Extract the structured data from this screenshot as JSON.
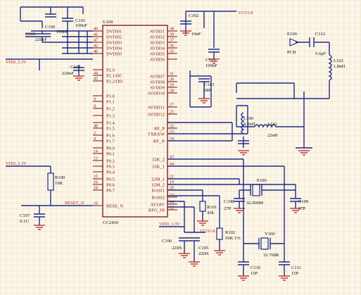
{
  "chip": {
    "designator": "U100",
    "part": "CC2430",
    "left_pins": [
      {
        "num": "40",
        "name": "DVDD1"
      },
      {
        "num": "41",
        "name": "DVDD2"
      },
      {
        "num": "47",
        "name": "DVDD3"
      },
      {
        "num": "42",
        "name": "DVDD4"
      },
      {
        "num": "46",
        "name": "DVDD5"
      },
      {
        "num": "",
        "name": "P2.0"
      },
      {
        "num": "44",
        "name": "P2.1/DC"
      },
      {
        "num": "45",
        "name": "P2.2/DD"
      },
      {
        "num": "",
        "name": "P1.0"
      },
      {
        "num": "9",
        "name": "P1.1"
      },
      {
        "num": "8",
        "name": "P1.2"
      },
      {
        "num": "",
        "name": "P1.3"
      },
      {
        "num": "",
        "name": "P1.4"
      },
      {
        "num": "48",
        "name": "P1.5"
      },
      {
        "num": "2",
        "name": "P1.6"
      },
      {
        "num": "4",
        "name": "P1.7"
      },
      {
        "num": "",
        "name": "P0.0"
      },
      {
        "num": "14",
        "name": "P0.1"
      },
      {
        "num": "13",
        "name": "P0.2"
      },
      {
        "num": "",
        "name": "P0.3"
      },
      {
        "num": "",
        "name": "P0.4"
      },
      {
        "num": "15",
        "name": "P0.5"
      },
      {
        "num": "16",
        "name": "P0.6"
      },
      {
        "num": "18",
        "name": "P0.7"
      },
      {
        "num": "10",
        "name": "RESE_N"
      }
    ],
    "right_pins": [
      {
        "num": "38",
        "name": "AVDD1"
      },
      {
        "num": "39",
        "name": "AVDD2"
      },
      {
        "num": "37",
        "name": "AVDD3"
      },
      {
        "num": "36",
        "name": "AVDD4"
      },
      {
        "num": "35",
        "name": "AVDD5"
      },
      {
        "num": "",
        "name": "AVDD6"
      },
      {
        "num": "31",
        "name": "AVDD7"
      },
      {
        "num": "30",
        "name": "AVDD8"
      },
      {
        "num": "29",
        "name": "AVDD9"
      },
      {
        "num": "28",
        "name": "AVDD10"
      },
      {
        "num": "27",
        "name": "AVDD11"
      },
      {
        "num": "25",
        "name": "AVDD12"
      },
      {
        "num": "32",
        "name": "RF_P"
      },
      {
        "num": "33",
        "name": "TXRXW"
      },
      {
        "num": "34",
        "name": "RF_N"
      },
      {
        "num": "43",
        "name": "32K_2"
      },
      {
        "num": "44",
        "name": "32K_1"
      },
      {
        "num": "21",
        "name": "32M_1"
      },
      {
        "num": "19",
        "name": "32M_2"
      },
      {
        "num": "20",
        "name": "BASI1"
      },
      {
        "num": "23",
        "name": "BASI2"
      },
      {
        "num": "24",
        "name": "AVI.8V"
      },
      {
        "num": "22",
        "name": "RFG_IN"
      }
    ]
  },
  "nets": {
    "vdd_left": "VDD_3.3V",
    "vdd_left2": "VDD_3.3V",
    "vdd_bottom": "VDD_3.3V",
    "vco_top": "VCO1.8",
    "vco_bottom": "VCO1.8",
    "reset": "RESET_N"
  },
  "components": {
    "c101": {
      "ref": "C101",
      "value": "100nF"
    },
    "c100": {
      "ref": "C100",
      "value": "100nF"
    },
    "c115": {
      "ref": "C115",
      "value": "220nF"
    },
    "c104": {
      "ref": "C104",
      "value": "220nF"
    },
    "c102": {
      "ref": "C102",
      "value": "10nF"
    },
    "c113": {
      "ref": "C113",
      "value": "100nF"
    },
    "c103": {
      "ref": "C103",
      "value": "68P"
    },
    "e100": {
      "ref": "E100",
      "value": "PCB"
    },
    "c112": {
      "ref": "C112",
      "value": "5.6pF"
    },
    "l102": {
      "ref": "L102",
      "value": "1.8nH"
    },
    "l100": {
      "ref": "L100",
      "value": "8.2nH"
    },
    "l101": {
      "ref": "L101",
      "value": "22nH"
    },
    "r100": {
      "ref": "R100",
      "value": "10K"
    },
    "c107": {
      "ref": "C107",
      "value": "0.1U"
    },
    "x100": {
      "ref": "X100",
      "value": "32.000M"
    },
    "c108": {
      "ref": "C108",
      "value": "27P"
    },
    "c109": {
      "ref": "C109",
      "value": "27P"
    },
    "r101": {
      "ref": "R101",
      "value": "43k"
    },
    "r102": {
      "ref": "R102",
      "value": "56K 1%"
    },
    "c106": {
      "ref": "C106",
      "value": "220N"
    },
    "c105": {
      "ref": "C105",
      "value": "220N"
    },
    "y100": {
      "ref": "Y100",
      "value": "32.768K"
    },
    "c110": {
      "ref": "C110",
      "value": "15P"
    },
    "c111": {
      "ref": "C111",
      "value": "15P"
    }
  }
}
